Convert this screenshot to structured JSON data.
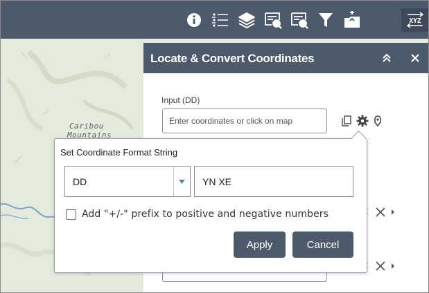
{
  "toolbar": {
    "icons": [
      "info-icon",
      "legend-icon",
      "layers-icon",
      "query-icon",
      "query-2-icon",
      "filter-icon",
      "add-data-icon",
      "coordinate-conversion-icon"
    ],
    "active_icon": "coordinate-conversion-icon",
    "coordinate_button_text": "XYZ"
  },
  "map": {
    "labels": [
      "Caribou",
      "Mountains"
    ]
  },
  "panel": {
    "title": "Locate & Convert Coordinates",
    "collapse_glyph": "≈",
    "close_glyph": "×",
    "input_label": "Input (DD)",
    "input_placeholder": "Enter coordinates or click on map",
    "output_icons": [
      "expand-icon",
      "remove-icon",
      "chevron-right-icon"
    ]
  },
  "popup": {
    "title": "Set Coordinate Format String",
    "format_selected": "DD",
    "format_string_value": "YN XE",
    "prefix_checkbox_label": "Add \"+/-\" prefix to positive and negative numbers",
    "prefix_checked": false,
    "apply_label": "Apply",
    "cancel_label": "Cancel"
  },
  "colors": {
    "toolbar": "#4d5a6b",
    "button": "#4d5a6b",
    "popup_border": "#8fa0b4"
  }
}
